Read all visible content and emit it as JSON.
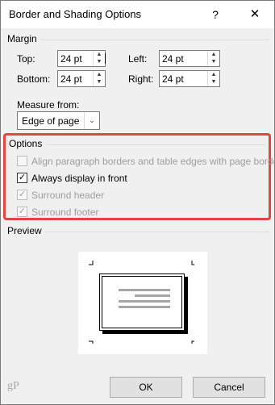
{
  "window": {
    "title": "Border and Shading Options",
    "help_label": "?",
    "close_label": "✕"
  },
  "margin": {
    "group_label": "Margin",
    "top_label": "Top:",
    "top_value": "24 pt",
    "left_label": "Left:",
    "left_value": "24 pt",
    "bottom_label": "Bottom:",
    "bottom_value": "24 pt",
    "right_label": "Right:",
    "right_value": "24 pt",
    "measure_label": "Measure from:",
    "measure_value": "Edge of page"
  },
  "options": {
    "group_label": "Options",
    "items": [
      {
        "label": "Align paragraph borders and table edges with page border",
        "checked": false,
        "enabled": false
      },
      {
        "label": "Always display in front",
        "checked": true,
        "enabled": true
      },
      {
        "label": "Surround header",
        "checked": true,
        "enabled": false
      },
      {
        "label": "Surround footer",
        "checked": true,
        "enabled": false
      }
    ],
    "highlight_color": "#e0473e"
  },
  "preview": {
    "group_label": "Preview"
  },
  "footer": {
    "ok_label": "OK",
    "cancel_label": "Cancel",
    "watermark": "gP"
  },
  "icons": {
    "spin_up": "▲",
    "spin_down": "▼",
    "dropdown": "⌄",
    "check": "✓"
  }
}
